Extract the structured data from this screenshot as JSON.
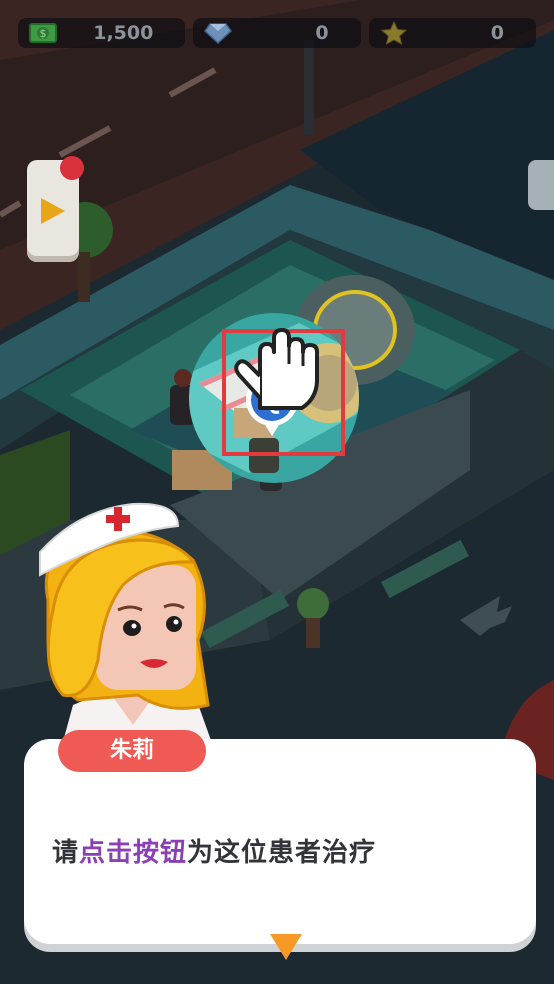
{
  "hud": {
    "cash": {
      "icon": "cash-icon",
      "value": "1,500"
    },
    "gems": {
      "icon": "gem-icon",
      "value": "0"
    },
    "stars": {
      "icon": "star-icon",
      "value": "0"
    }
  },
  "side_button": {
    "icon": "play-icon"
  },
  "tutorial": {
    "target_icon": "stethoscope-icon",
    "pointer_icon": "pointing-hand-icon"
  },
  "dialog": {
    "speaker": "朱莉",
    "text_before": "请",
    "text_highlight": "点击按钮",
    "text_after": "为这位患者治疗",
    "continue_icon": "down-arrow-icon"
  },
  "colors": {
    "highlight": "#8b3fb5",
    "name_tag": "#f05a55",
    "frame": "#e23b3f",
    "continue": "#f79a25"
  }
}
